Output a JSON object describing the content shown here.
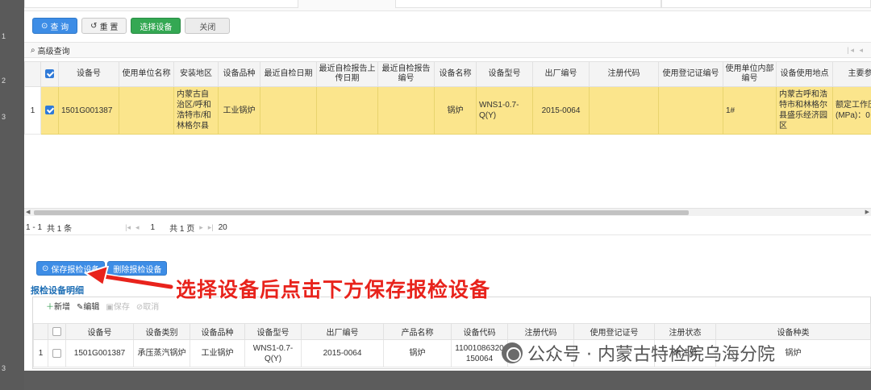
{
  "toolbar": {
    "query": "查 询",
    "reset": "重 置",
    "select_device": "选择设备",
    "close": "关闭"
  },
  "search": {
    "advanced": "高级查询"
  },
  "grid1": {
    "headers": [
      "设备号",
      "使用单位名称",
      "安装地区",
      "设备品种",
      "最近自检日期",
      "最近自检报告上传日期",
      "最近自检报告编号",
      "设备名称",
      "设备型号",
      "出厂编号",
      "注册代码",
      "使用登记证编号",
      "使用单位内部编号",
      "设备使用地点",
      "主要参"
    ],
    "row": {
      "index": "1",
      "device_no": "1501G001387",
      "unit_name": "",
      "region": "内蒙古自治区/呼和浩特市/和林格尔县",
      "variety": "工业锅炉",
      "last_check_date": "",
      "last_upload_date": "",
      "last_report_no": "",
      "device_name": "锅炉",
      "model": "WNS1-0.7-Q(Y)",
      "factory_no": "2015-0064",
      "reg_code": "",
      "reg_cert_no": "",
      "internal_no": "1#",
      "location": "内蒙古呼和浩特市和林格尔县盛乐经济园区",
      "main_params": "额定工作压(MPa)：0"
    }
  },
  "pager1": {
    "range": "1 - 1",
    "total": "共 1 条",
    "page": "1",
    "pages": "共 1 页",
    "page_size": "20"
  },
  "toolbar2": {
    "save": "保存报检设备",
    "delete": "删除报检设备"
  },
  "detail": {
    "title": "报检设备明细"
  },
  "toolbar3": {
    "add": "新增",
    "edit": "编辑",
    "save": "保存",
    "cancel": "取消"
  },
  "grid2": {
    "headers": [
      "设备号",
      "设备类别",
      "设备品种",
      "设备型号",
      "出厂编号",
      "产品名称",
      "设备代码",
      "注册代码",
      "使用登记证号",
      "注册状态",
      "设备种类"
    ],
    "row": {
      "index": "1",
      "device_no": "1501G001387",
      "category": "承压蒸汽锅炉",
      "variety": "工业锅炉",
      "model": "WNS1-0.7-Q(Y)",
      "factory_no": "2015-0064",
      "product_name": "锅炉",
      "device_code": "11001086320150064",
      "reg_code": "",
      "reg_cert_no": "",
      "reg_status": "未注册",
      "device_kind": "锅炉"
    }
  },
  "annotation": "选择设备后点击下方保存报检设备",
  "watermark": "公众号 · 内蒙古特检院乌海分院",
  "colors": {
    "primary": "#3d8de6",
    "success": "#34a853",
    "highlight_row": "#fbe58c",
    "annotation": "#e8231c"
  }
}
